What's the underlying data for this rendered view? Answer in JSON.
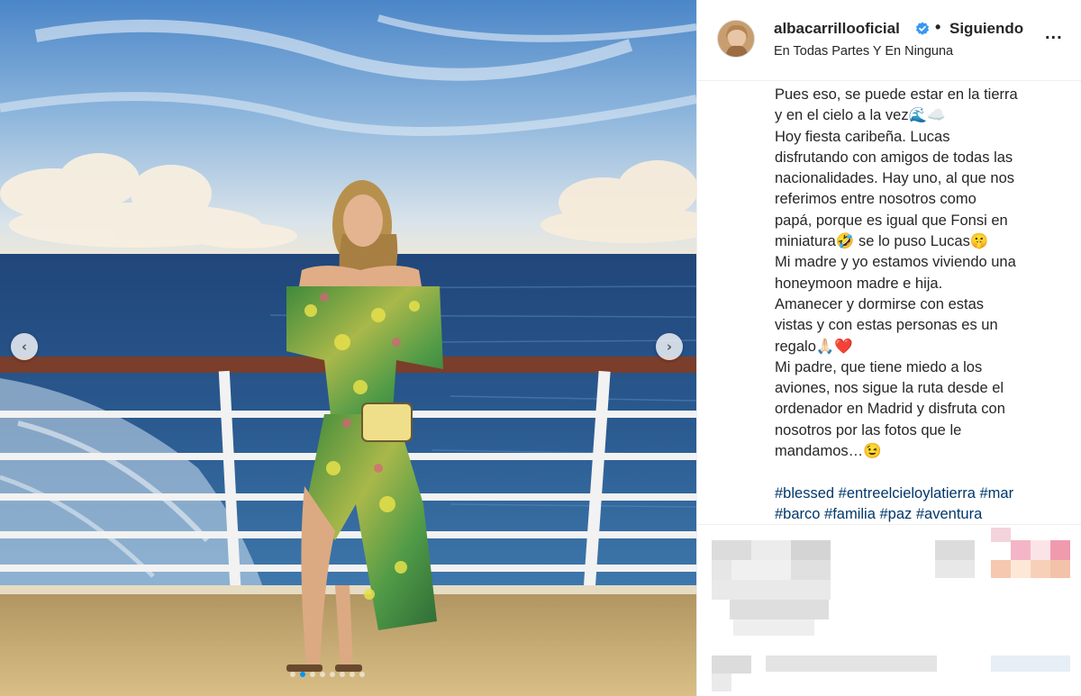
{
  "post": {
    "author": {
      "username": "albacarrillooficial",
      "verified": true,
      "location": "En Todas Partes Y En Ninguna",
      "follow_status": "Siguiendo",
      "separator": "•",
      "more_label": "..."
    },
    "caption_lines": [
      "Pues eso, se puede estar en la tierra",
      "y en el cielo a la vez🌊☁️",
      "Hoy fiesta caribeña. Lucas",
      "disfrutando con amigos de todas las",
      "nacionalidades. Hay uno, al que nos",
      "referimos entre nosotros como",
      "papá, porque es igual que Fonsi en",
      "miniatura🤣 se lo puso Lucas🤫",
      "Mi madre y yo estamos viviendo una",
      "honeymoon madre e hija.",
      "Amanecer y dormirse con estas",
      "vistas y con estas personas es un",
      "regalo🙏🏻❤️",
      "Mi padre, que tiene miedo a los",
      "aviones, nos sigue la ruta desde el",
      "ordenador en Madrid y disfruta con",
      "nosotros por las fotos que le",
      "mandamos…😉"
    ],
    "hashtags": [
      "#blessed",
      "#entreelcieloylatierra",
      "#mar",
      "#barco",
      "#familia",
      "#paz",
      "#aventura"
    ],
    "carousel": {
      "total": 8,
      "active": 2,
      "prev_label": "‹",
      "next_label": "›"
    }
  },
  "icons": {
    "verified": "verified-badge-icon",
    "prev": "chevron-left-icon",
    "next": "chevron-right-icon",
    "more": "more-options-icon"
  },
  "colors": {
    "verified_blue": "#3897f0",
    "hashtag": "#00376b",
    "dot_active": "#0095f6",
    "text": "#262626"
  }
}
